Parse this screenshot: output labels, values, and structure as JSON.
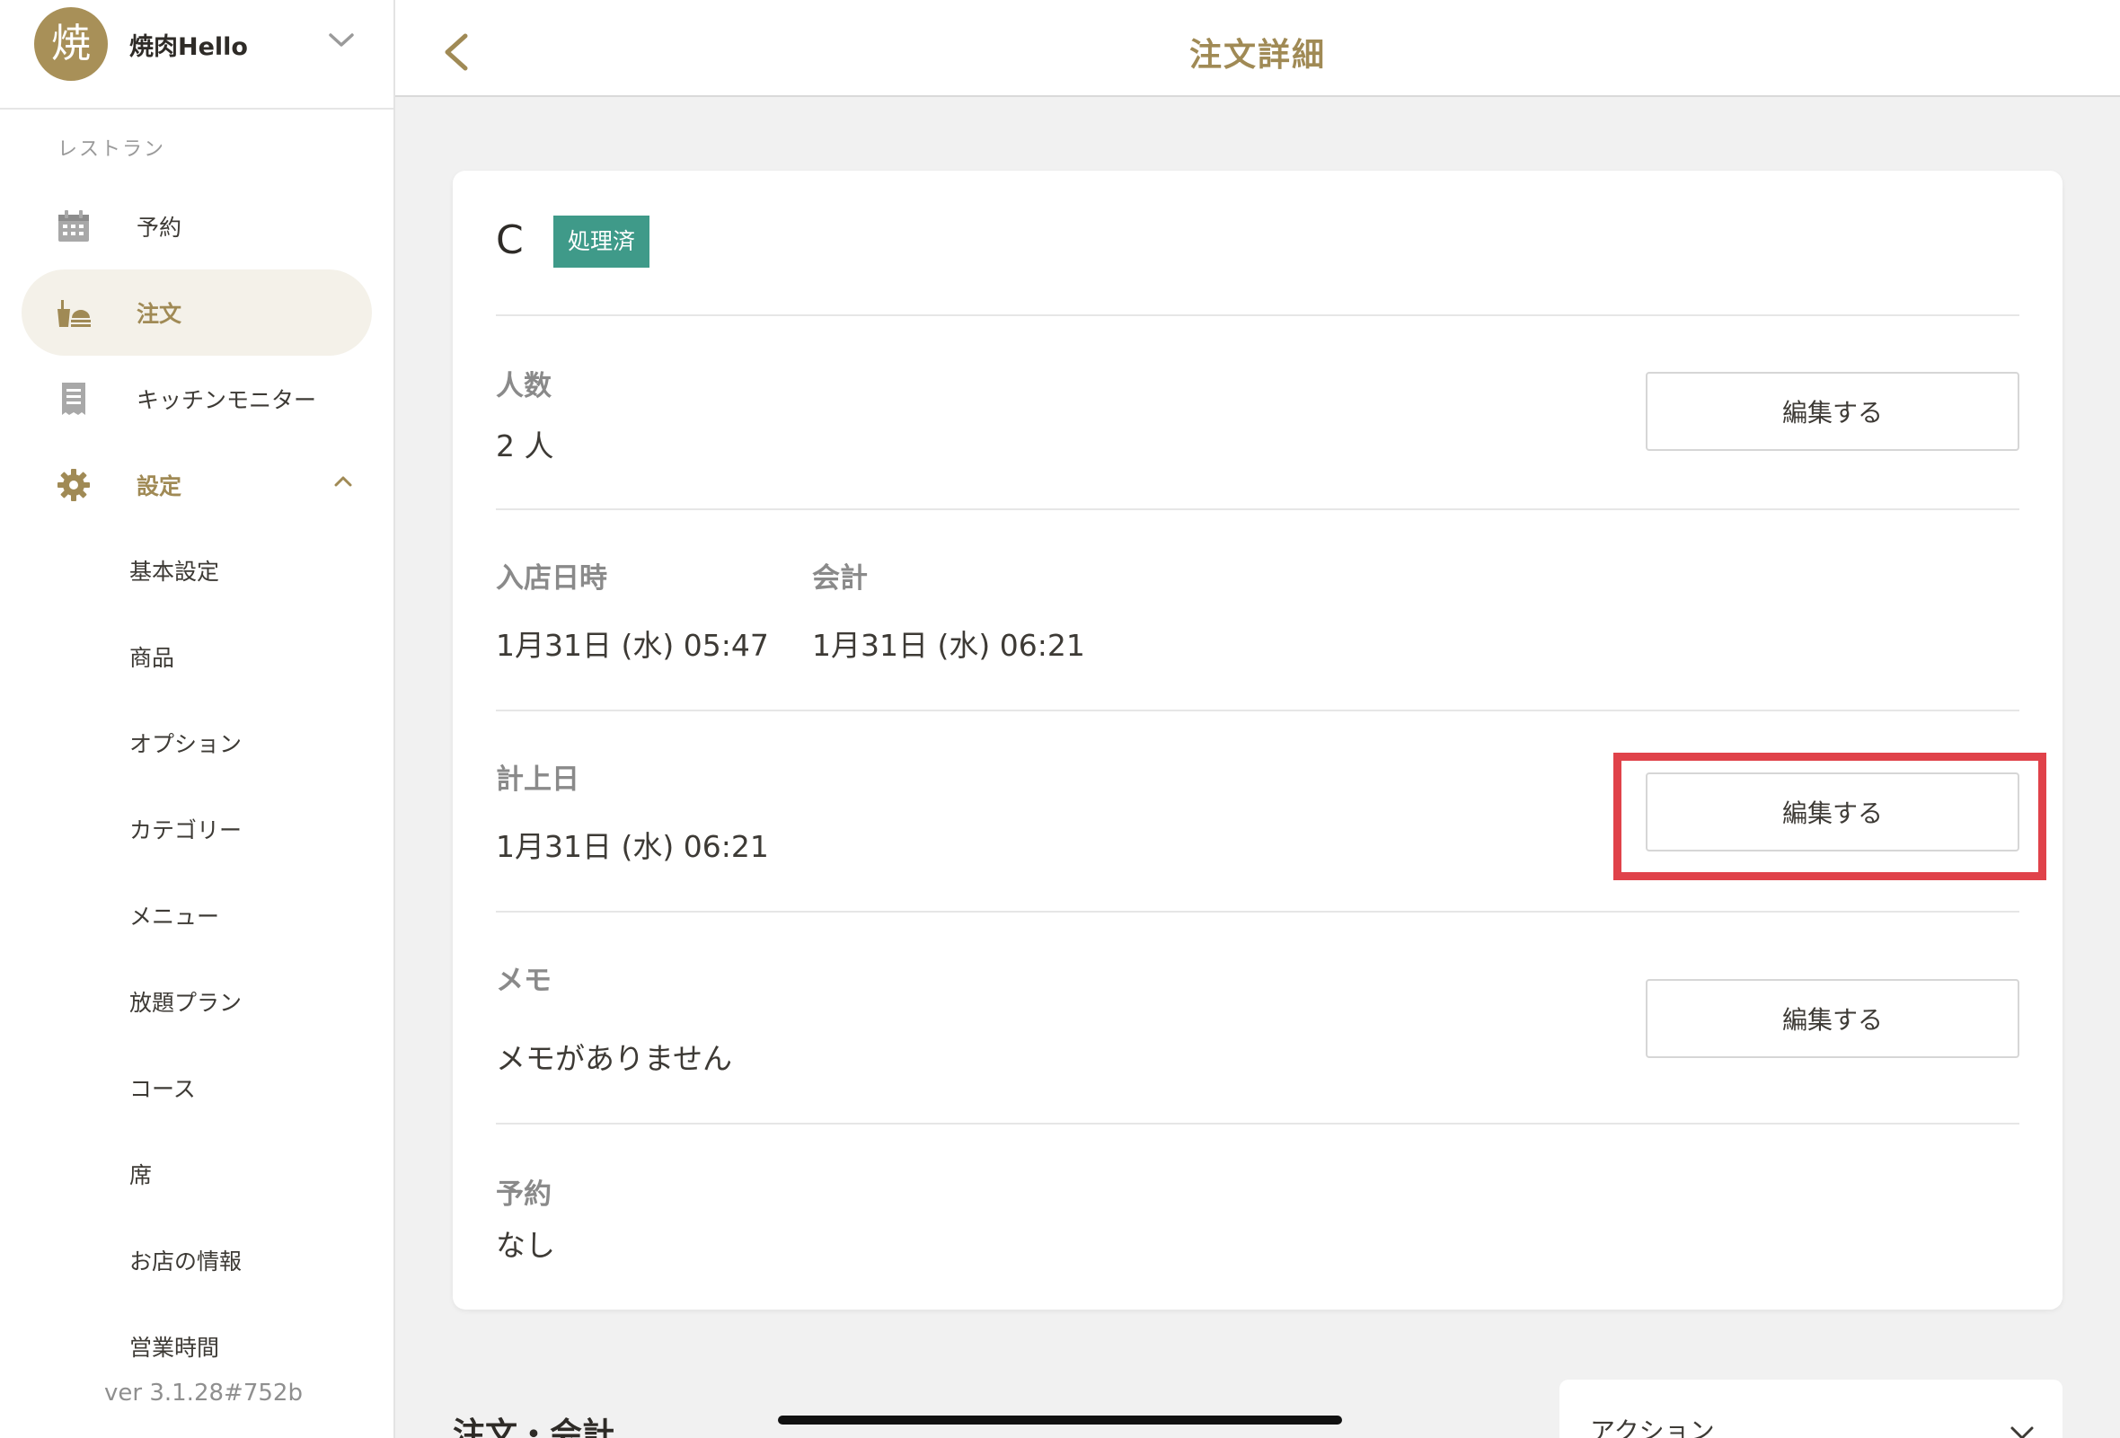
{
  "sidebar": {
    "store": {
      "avatar_text": "焼",
      "name": "焼肉Hello"
    },
    "section_label": "レストラン",
    "nav": [
      {
        "label": "予約",
        "icon": "calendar-icon"
      },
      {
        "label": "注文",
        "icon": "order-tray-icon"
      },
      {
        "label": "キッチンモニター",
        "icon": "receipt-icon"
      },
      {
        "label": "設定",
        "icon": "gear-icon"
      }
    ],
    "settings_items": [
      "基本設定",
      "商品",
      "オプション",
      "カテゴリー",
      "メニュー",
      "放題プラン",
      "コース",
      "席",
      "お店の情報",
      "営業時間"
    ],
    "version": "ver 3.1.28#752b"
  },
  "topbar": {
    "title": "注文詳細"
  },
  "order": {
    "name": "C",
    "status": "処理済",
    "guests": {
      "label": "人数",
      "value": "2 人"
    },
    "entry_time": {
      "label": "入店日時",
      "value": "1月31日 (水) 05:47"
    },
    "checkout_time": {
      "label": "会計",
      "value": "1月31日 (水) 06:21"
    },
    "booking_date": {
      "label": "計上日",
      "value": "1月31日 (水) 06:21"
    },
    "memo": {
      "label": "メモ",
      "value": "メモがありません"
    },
    "reservation": {
      "label": "予約",
      "value": "なし"
    },
    "edit_label": "編集する"
  },
  "bottom": {
    "section_heading": "注文・会計",
    "action_label": "アクション"
  },
  "colors": {
    "accent": "#a08a55",
    "status": "#3f9a89",
    "highlight": "#e0424a"
  }
}
